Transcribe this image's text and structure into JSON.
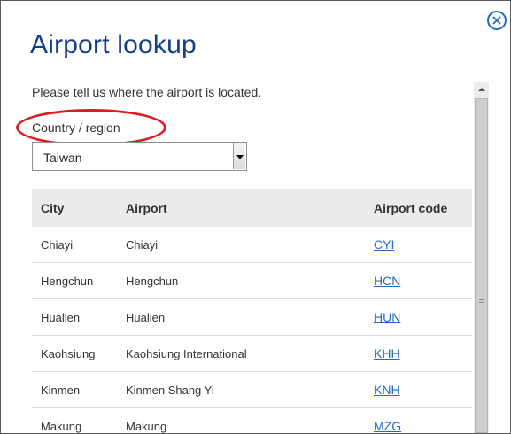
{
  "dialog": {
    "title": "Airport lookup",
    "prompt": "Please tell us where the airport is located.",
    "country_label": "Country / region",
    "country_selected": "Taiwan",
    "close_icon": "close-circle-icon"
  },
  "table": {
    "headers": {
      "city": "City",
      "airport": "Airport",
      "code": "Airport code"
    },
    "rows": [
      {
        "city": "Chiayi",
        "airport": "Chiayi",
        "code": "CYI"
      },
      {
        "city": "Hengchun",
        "airport": "Hengchun",
        "code": "HCN"
      },
      {
        "city": "Hualien",
        "airport": "Hualien",
        "code": "HUN"
      },
      {
        "city": "Kaohsiung",
        "airport": "Kaohsiung International",
        "code": "KHH"
      },
      {
        "city": "Kinmen",
        "airport": "Kinmen Shang Yi",
        "code": "KNH"
      },
      {
        "city": "Makung",
        "airport": "Makung",
        "code": "MZG"
      }
    ]
  },
  "colors": {
    "title": "#123e8a",
    "link": "#1e6cc8",
    "annotation": "#e0191e",
    "header_bg": "#ebebeb"
  }
}
